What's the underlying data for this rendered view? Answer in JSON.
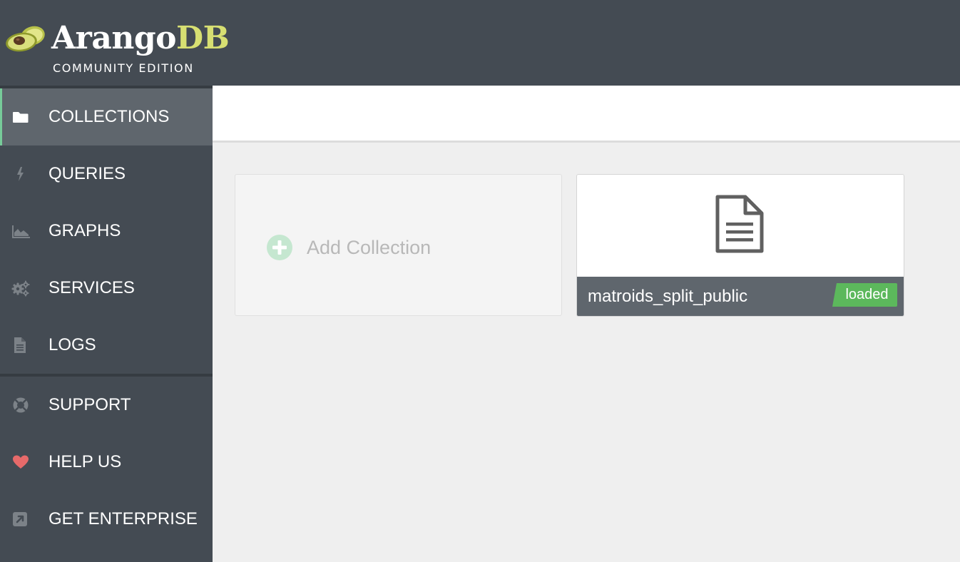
{
  "brand": {
    "name_part1": "Arango",
    "name_part2": "DB",
    "edition": "COMMUNITY EDITION"
  },
  "sidebar": {
    "items": [
      {
        "label": "COLLECTIONS",
        "icon": "folder-icon",
        "active": true
      },
      {
        "label": "QUERIES",
        "icon": "bolt-icon"
      },
      {
        "label": "GRAPHS",
        "icon": "area-chart-icon"
      },
      {
        "label": "SERVICES",
        "icon": "gears-icon"
      },
      {
        "label": "LOGS",
        "icon": "file-text-icon"
      }
    ],
    "footer_items": [
      {
        "label": "SUPPORT",
        "icon": "life-ring-icon"
      },
      {
        "label": "HELP US",
        "icon": "heart-icon"
      },
      {
        "label": "GET ENTERPRISE",
        "icon": "external-link-icon"
      }
    ]
  },
  "main": {
    "add_collection_label": "Add Collection",
    "collections": [
      {
        "name": "matroids_split_public",
        "status": "loaded",
        "icon": "document-icon"
      }
    ]
  },
  "colors": {
    "sidebar_bg": "#444b53",
    "active_item_bg": "#5f666d",
    "active_accent": "#77cb99",
    "brand_accent": "#d7df72",
    "status_loaded": "#5cb85c",
    "heart": "#e76a6a",
    "content_bg": "#efefef"
  }
}
